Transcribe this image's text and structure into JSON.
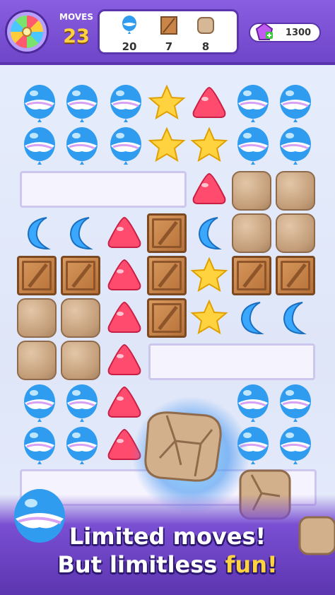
{
  "hud": {
    "moves_label": "MOVES",
    "moves_value": "23",
    "goals": [
      {
        "icon": "balloon-icon",
        "count": "20"
      },
      {
        "icon": "crate-icon",
        "count": "7"
      },
      {
        "icon": "rock-icon",
        "count": "8"
      }
    ],
    "gems_value": "1300",
    "gem_icon": "gem-plus-icon"
  },
  "colors": {
    "topbar": "#7a4fd3",
    "moves_value": "#ffd23f",
    "balloon_blue": "#2f9cf0",
    "candy_red": "#ff4b6e",
    "star_yellow": "#ffd23f",
    "moon_blue": "#3aa8ff"
  },
  "banner": {
    "line1": "Limited moves!",
    "line2_prefix": "But limitless",
    "line2_accent": "fun!"
  }
}
